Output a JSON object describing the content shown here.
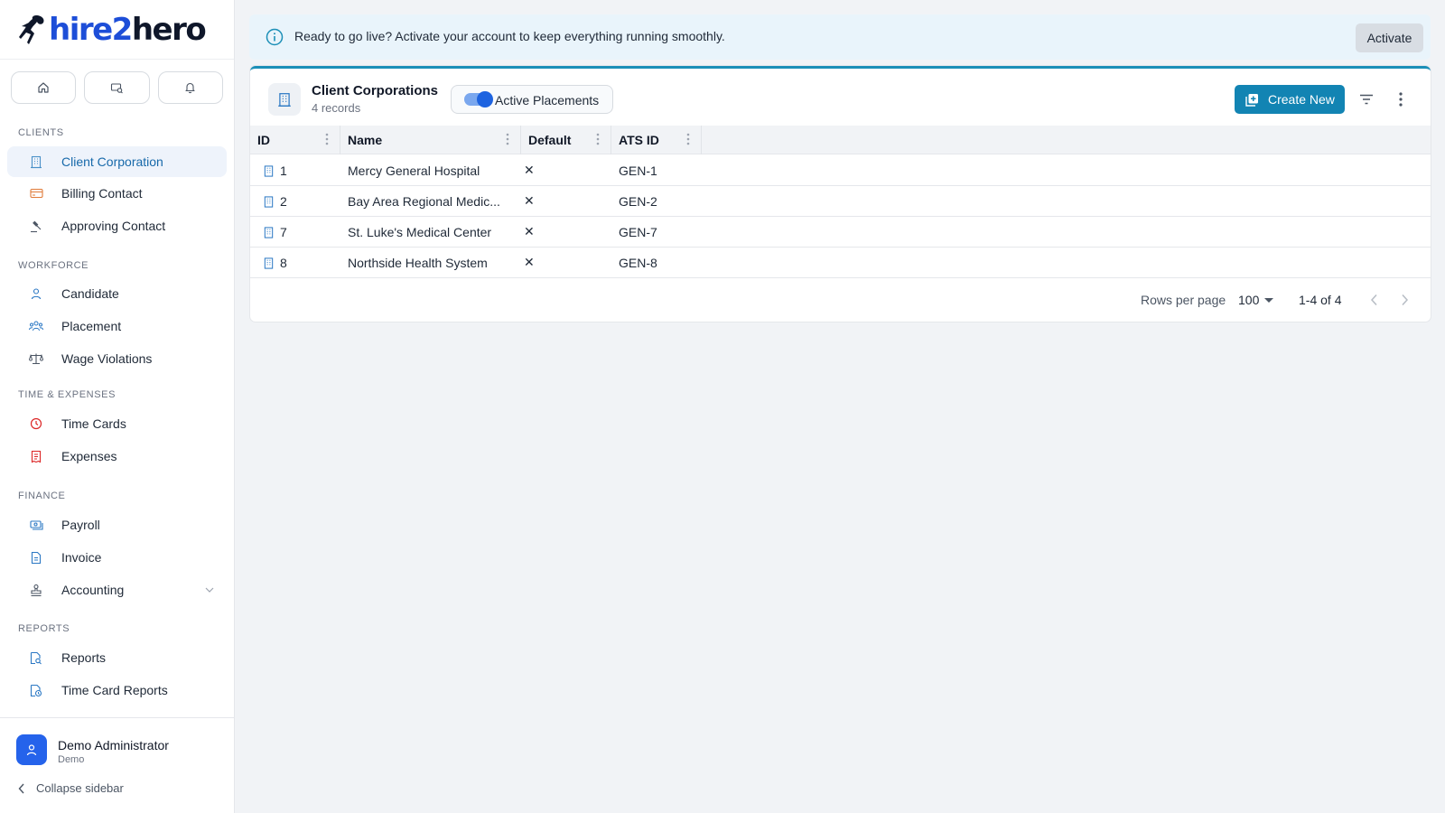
{
  "brand": {
    "part1": "hire2",
    "part2": "hero",
    "accent": "#1d4ed8"
  },
  "quick_actions": [
    {
      "icon": "home-icon"
    },
    {
      "icon": "search-list-icon"
    },
    {
      "icon": "bell-icon"
    }
  ],
  "sidebar": {
    "sections": [
      {
        "title": "CLIENTS",
        "items": [
          {
            "label": "Client Corporation",
            "icon": "building-icon",
            "active": true
          },
          {
            "label": "Billing Contact",
            "icon": "credit-card-icon"
          },
          {
            "label": "Approving Contact",
            "icon": "gavel-icon"
          }
        ]
      },
      {
        "title": "WORKFORCE",
        "items": [
          {
            "label": "Candidate",
            "icon": "person-icon"
          },
          {
            "label": "Placement",
            "icon": "people-icon"
          },
          {
            "label": "Wage Violations",
            "icon": "scale-icon"
          }
        ]
      },
      {
        "title": "TIME & EXPENSES",
        "items": [
          {
            "label": "Time Cards",
            "icon": "clock-icon"
          },
          {
            "label": "Expenses",
            "icon": "receipt-icon"
          }
        ]
      },
      {
        "title": "FINANCE",
        "items": [
          {
            "label": "Payroll",
            "icon": "money-icon"
          },
          {
            "label": "Invoice",
            "icon": "invoice-icon"
          },
          {
            "label": "Accounting",
            "icon": "stamp-icon",
            "expandable": true
          }
        ]
      },
      {
        "title": "REPORTS",
        "items": [
          {
            "label": "Reports",
            "icon": "report-search-icon"
          },
          {
            "label": "Time Card Reports",
            "icon": "report-clock-icon"
          }
        ]
      }
    ]
  },
  "user": {
    "name": "Demo Administrator",
    "org": "Demo",
    "collapse_label": "Collapse sidebar"
  },
  "banner": {
    "message": "Ready to go live? Activate your account to keep everything running smoothly.",
    "action": "Activate"
  },
  "card": {
    "title": "Client Corporations",
    "subtitle": "4 records",
    "filter_chip": {
      "label": "Active Placements",
      "enabled": true
    },
    "create_label": "Create New"
  },
  "table": {
    "columns": [
      "ID",
      "Name",
      "Default",
      "ATS ID"
    ],
    "rows": [
      {
        "id": "1",
        "name": "Mercy General Hospital",
        "default": "✕",
        "ats_id": "GEN-1"
      },
      {
        "id": "2",
        "name": "Bay Area Regional Medic...",
        "default": "✕",
        "ats_id": "GEN-2"
      },
      {
        "id": "7",
        "name": "St. Luke's Medical Center",
        "default": "✕",
        "ats_id": "GEN-7"
      },
      {
        "id": "8",
        "name": "Northside Health System",
        "default": "✕",
        "ats_id": "GEN-8"
      }
    ]
  },
  "pagination": {
    "rows_per_page_label": "Rows per page",
    "rows_per_page": "100",
    "range": "1-4 of 4"
  },
  "colors": {
    "primary": "#1284b3",
    "active_nav": "#1769aa",
    "banner_bg": "#e9f4fb"
  }
}
